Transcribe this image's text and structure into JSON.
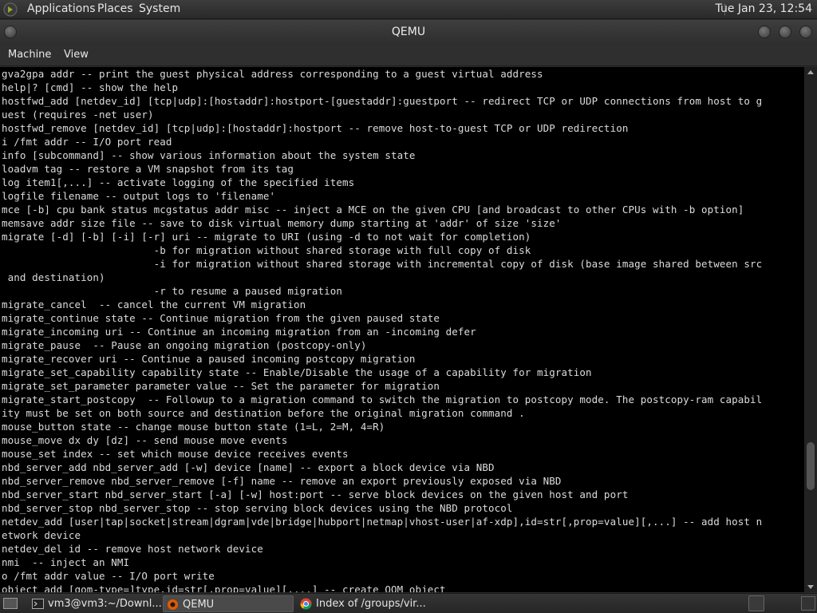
{
  "top_panel": {
    "menus": [
      "Applications",
      "Places",
      "System"
    ],
    "clock": "Tue Jan 23, 12:54"
  },
  "window": {
    "title": "QEMU"
  },
  "menubar": {
    "items": [
      "Machine",
      "View"
    ]
  },
  "console": {
    "lines": [
      "gva2gpa addr -- print the guest physical address corresponding to a guest virtual address",
      "help|? [cmd] -- show the help",
      "hostfwd_add [netdev_id] [tcp|udp]:[hostaddr]:hostport-[guestaddr]:guestport -- redirect TCP or UDP connections from host to g",
      "uest (requires -net user)",
      "hostfwd_remove [netdev_id] [tcp|udp]:[hostaddr]:hostport -- remove host-to-guest TCP or UDP redirection",
      "i /fmt addr -- I/O port read",
      "info [subcommand] -- show various information about the system state",
      "loadvm tag -- restore a VM snapshot from its tag",
      "log item1[,...] -- activate logging of the specified items",
      "logfile filename -- output logs to 'filename'",
      "mce [-b] cpu bank status mcgstatus addr misc -- inject a MCE on the given CPU [and broadcast to other CPUs with -b option]",
      "memsave addr size file -- save to disk virtual memory dump starting at 'addr' of size 'size'",
      "migrate [-d] [-b] [-i] [-r] uri -- migrate to URI (using -d to not wait for completion)",
      "                         -b for migration without shared storage with full copy of disk",
      "                         -i for migration without shared storage with incremental copy of disk (base image shared between src",
      " and destination)",
      "                         -r to resume a paused migration",
      "migrate_cancel  -- cancel the current VM migration",
      "migrate_continue state -- Continue migration from the given paused state",
      "migrate_incoming uri -- Continue an incoming migration from an -incoming defer",
      "migrate_pause  -- Pause an ongoing migration (postcopy-only)",
      "migrate_recover uri -- Continue a paused incoming postcopy migration",
      "migrate_set_capability capability state -- Enable/Disable the usage of a capability for migration",
      "migrate_set_parameter parameter value -- Set the parameter for migration",
      "migrate_start_postcopy  -- Followup to a migration command to switch the migration to postcopy mode. The postcopy-ram capabil",
      "ity must be set on both source and destination before the original migration command .",
      "mouse_button state -- change mouse button state (1=L, 2=M, 4=R)",
      "mouse_move dx dy [dz] -- send mouse move events",
      "mouse_set index -- set which mouse device receives events",
      "nbd_server_add nbd_server_add [-w] device [name] -- export a block device via NBD",
      "nbd_server_remove nbd_server_remove [-f] name -- remove an export previously exposed via NBD",
      "nbd_server_start nbd_server_start [-a] [-w] host:port -- serve block devices on the given host and port",
      "nbd_server_stop nbd_server_stop -- stop serving block devices using the NBD protocol",
      "netdev_add [user|tap|socket|stream|dgram|vde|bridge|hubport|netmap|vhost-user|af-xdp],id=str[,prop=value][,...] -- add host n",
      "etwork device",
      "netdev_del id -- remove host network device",
      "nmi  -- inject an NMI",
      "o /fmt addr value -- I/O port write",
      "object_add [qom-type=]type,id=str[,prop=value][,...] -- create QOM object"
    ]
  },
  "taskbar": {
    "tasks": [
      {
        "label": "vm3@vm3:~/Downl...",
        "icon": "terminal-icon",
        "active": false
      },
      {
        "label": "QEMU",
        "icon": "qemu-icon",
        "active": true
      },
      {
        "label": "Index of /groups/vir...",
        "icon": "chrome-icon",
        "active": false
      }
    ]
  },
  "colors": {
    "console_bg": "#000000",
    "console_fg": "#dcdcdc",
    "panel_bg": "#2e2e2e"
  }
}
